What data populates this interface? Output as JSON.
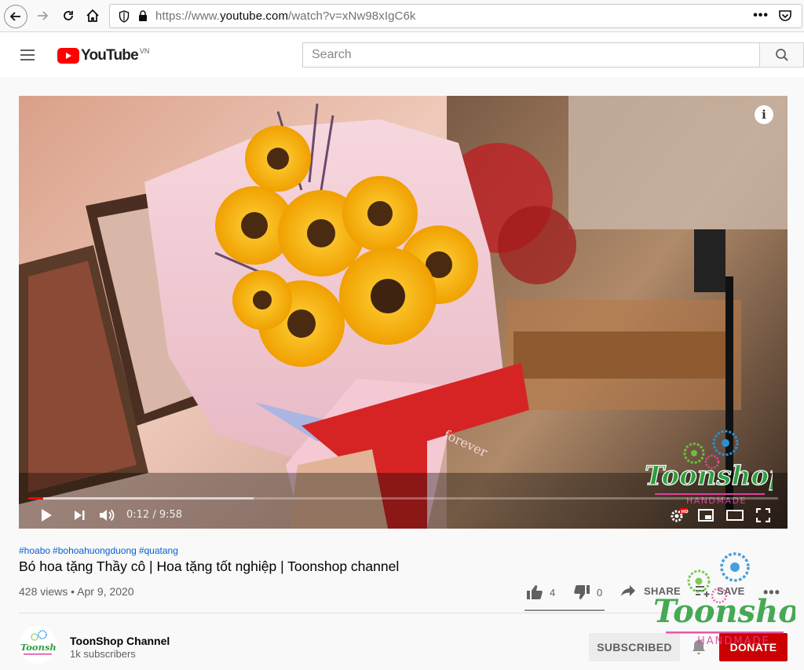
{
  "browser": {
    "url_prefix": "https://www.",
    "url_domain": "youtube.com",
    "url_path": "/watch?v=xNw98xIgC6k"
  },
  "header": {
    "logo_text": "YouTube",
    "logo_region": "VN",
    "search_placeholder": "Search"
  },
  "player": {
    "time": "0:12 / 9:58",
    "progress_fraction": 0.02,
    "buffer_fraction": 0.3,
    "video_ribbon_text": "forever",
    "watermark_title": "Toonshop",
    "watermark_sub": "HANDMADE"
  },
  "video": {
    "hashtags": [
      "#hoabo",
      "#bohoahuongduong",
      "#quatang"
    ],
    "title": "Bó hoa tặng Thầy cô | Hoa tặng tốt nghiệp | Toonshop channel",
    "meta": "428 views • Apr 9, 2020",
    "likes": "4",
    "dislikes": "0",
    "share_label": "SHARE",
    "save_label": "SAVE"
  },
  "channel": {
    "name": "ToonShop Channel",
    "subscribers": "1k subscribers",
    "avatar_text": "Toonshop",
    "subscribed_label": "SUBSCRIBED",
    "donate_label": "DONATE"
  },
  "colors": {
    "yt_red": "#ff0000",
    "link_blue": "#065fd4",
    "donate_red": "#cc0000",
    "watermark_green": "#2e9e3e",
    "watermark_pink": "#e0409a"
  }
}
